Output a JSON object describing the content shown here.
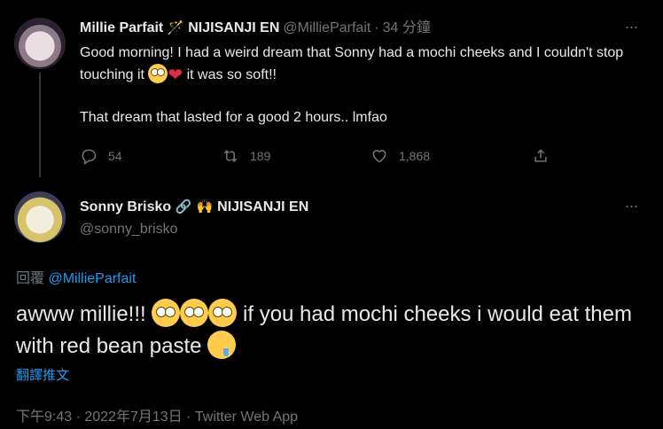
{
  "tweet1": {
    "name": "Millie Parfait",
    "badge_emoji": "🪄",
    "org": "NIJISANJI EN",
    "handle": "@MillieParfait",
    "separator": "·",
    "time": "34 分鐘",
    "more_glyph": "···",
    "line1": "Good morning! I had a weird dream that Sonny had a mochi cheeks and I couldn't stop touching it",
    "line1_end": " it was so soft!!",
    "line2": "That dream that lasted for a good 2 hours.. lmfao",
    "heart_glyph": "❤",
    "replies": "54",
    "retweets": "189",
    "likes": "1,868"
  },
  "tweet2": {
    "name": "Sonny Brisko",
    "badge1": "🔗",
    "badge2": "🙌",
    "org": "NIJISANJI EN",
    "handle": "@sonny_brisko",
    "more_glyph": "···",
    "replying_prefix": "回覆",
    "replying_to": "@MillieParfait",
    "text_start": "awww millie!!! ",
    "text_mid": " if you had mochi cheeks i would eat them with red bean paste ",
    "translate": "翻譯推文",
    "timestamp": "下午9:43 · 2022年7月13日 · Twitter Web App"
  },
  "colors": {
    "background": "#000000",
    "text": "#e7e9ea",
    "secondary": "#71767b",
    "link": "#1d9bf0"
  },
  "icons": [
    "avatar-millie",
    "avatar-sonny",
    "reply-icon",
    "retweet-icon",
    "like-icon",
    "share-icon",
    "more-icon"
  ]
}
